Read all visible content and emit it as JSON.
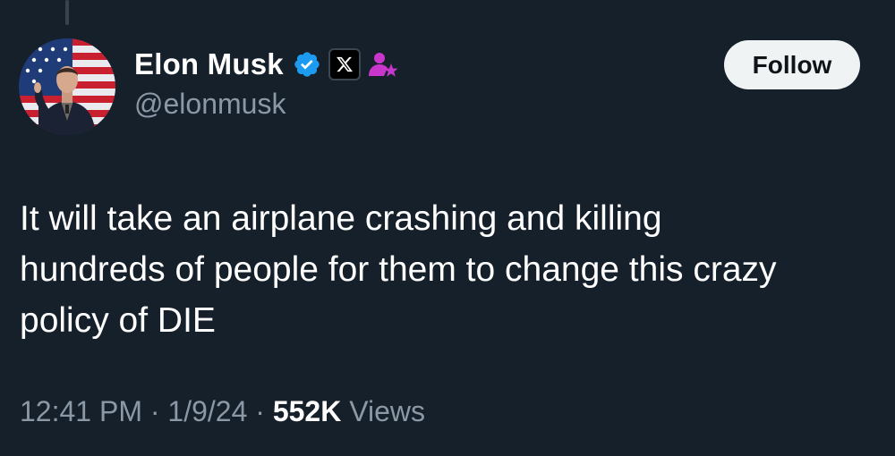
{
  "author": {
    "display_name": "Elon Musk",
    "handle": "@elonmusk"
  },
  "icons": {
    "verified": "verified-badge-icon",
    "affiliation": "x-logo-icon",
    "affiliate_star": "person-star-icon"
  },
  "colors": {
    "background": "#15202b",
    "verified_blue": "#1d9bf0",
    "affiliate_purple": "#c936cc",
    "muted_text": "#8b98a5"
  },
  "follow_button": {
    "label": "Follow"
  },
  "tweet": {
    "text_line1": "It will take an airplane crashing and killing",
    "text_line2": "hundreds of people for them to change this crazy",
    "text_line3": "policy of DIE"
  },
  "meta": {
    "time": "12:41 PM",
    "date": "1/9/24",
    "views_count": "552K",
    "views_label": "Views",
    "separator": "·"
  }
}
